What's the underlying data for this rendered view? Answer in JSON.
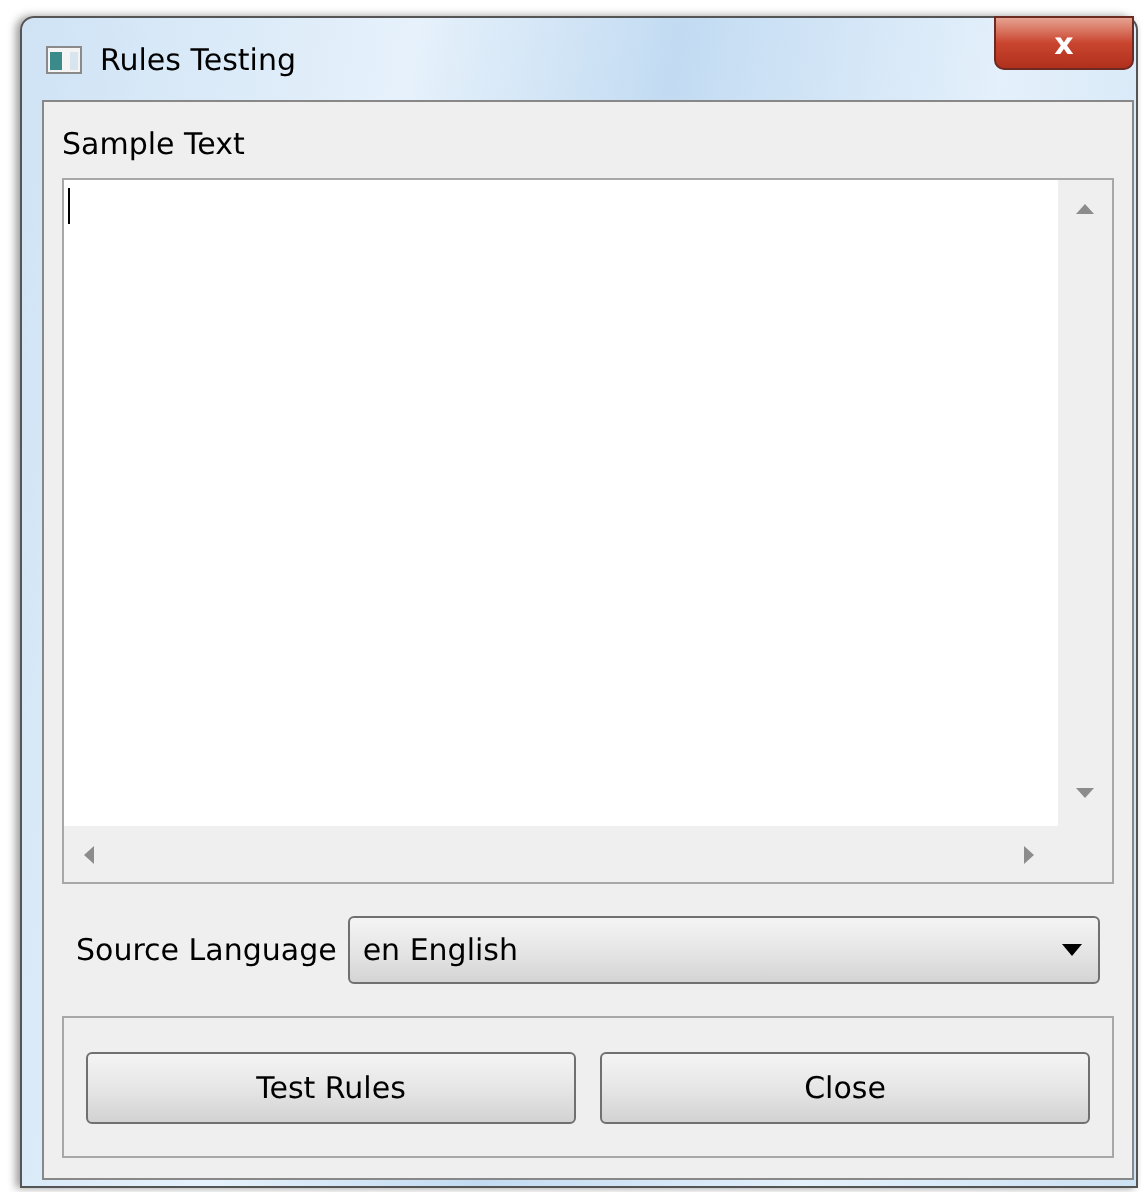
{
  "window": {
    "title": "Rules Testing",
    "close_button": "x"
  },
  "sample_text": {
    "label": "Sample Text"
  },
  "source_language": {
    "label": "Source Language",
    "value": "en English"
  },
  "buttons": [
    "Test Rules",
    "Close"
  ]
}
